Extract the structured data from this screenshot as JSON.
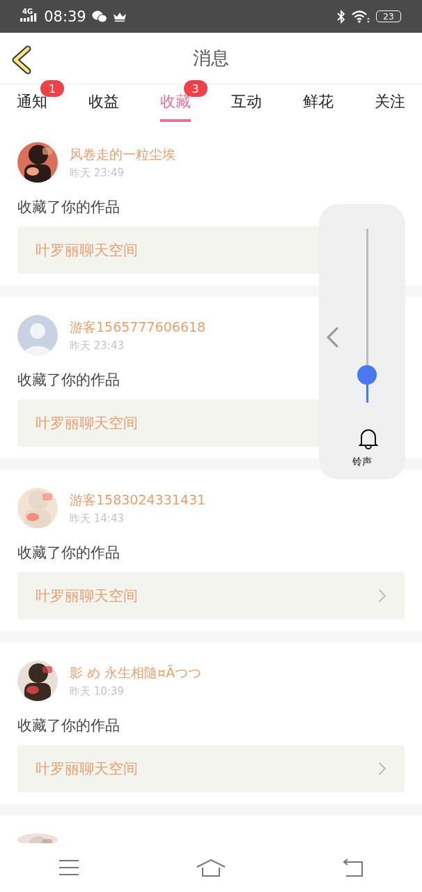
{
  "status_bar": {
    "network": "4G",
    "time": "08:39",
    "battery": "23"
  },
  "header": {
    "title": "消息"
  },
  "tabs": [
    {
      "label": "通知",
      "badge": "1",
      "selected": false
    },
    {
      "label": "收益",
      "selected": false
    },
    {
      "label": "收藏",
      "badge": "3",
      "selected": true
    },
    {
      "label": "互动",
      "selected": false
    },
    {
      "label": "鲜花",
      "selected": false
    },
    {
      "label": "关注",
      "selected": false
    }
  ],
  "messages": [
    {
      "kind": "covered",
      "name": "风卷走的一粒尘埃",
      "time": "昨天 23:49",
      "action": "收藏了你的作品",
      "work": "叶罗丽聊天空间"
    },
    {
      "kind": "covered",
      "avatar": {
        "kind": "silhouette"
      },
      "name": "游客1565777606618",
      "time": "昨天 23:43",
      "action": "收藏了你的作品",
      "work": "叶罗丽聊天空间"
    },
    {
      "kind": "full",
      "name": "游客1583024331431",
      "time": "昨天 14:43",
      "action": "收藏了你的作品",
      "work": "叶罗丽聊天空间"
    },
    {
      "kind": "full",
      "name": "影 め 永生相隨¤Ãつつ",
      "time": "昨天 10:39",
      "action": "收藏了你的作品",
      "work": "叶罗丽聊天空间"
    },
    {
      "kind": "clipped"
    }
  ],
  "volume_panel": {
    "label": "铃声",
    "level": 0.16
  }
}
